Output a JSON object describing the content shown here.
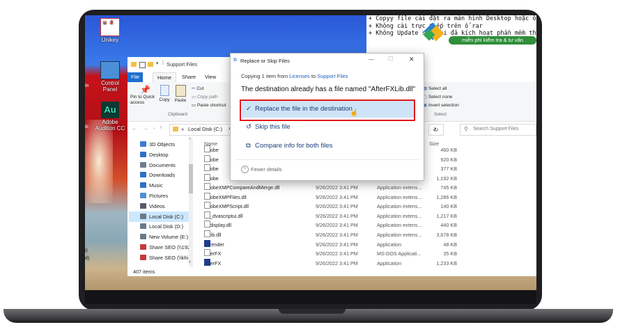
{
  "desktop": {
    "icons": [
      {
        "label": "Unikey"
      },
      {
        "label": "Control Panel"
      },
      {
        "label": "Adobe Audition CC"
      }
    ],
    "left_edge_text": [
      "in",
      "ic",
      "i)",
      "d)"
    ]
  },
  "console": {
    "lines": [
      "+ Copyy file cài đặt ra màn hình Desktop hoặc ổ",
      "+ Không cài trực tiếp trên ổ rar",
      "+ Không Update sau khi đã kích hoạt phần mềm thành"
    ]
  },
  "watermark": {
    "badge": "miễn phí kiểm tra & tư vấn"
  },
  "explorer": {
    "title": "Support Files",
    "tabs": [
      "File",
      "Home",
      "Share",
      "View"
    ],
    "ribbon": {
      "pin_label": "Pin to Quick access",
      "copy_label": "Copy",
      "paste_label": "Paste",
      "cut_label": "Cut",
      "copy_path_label": "Copy path",
      "paste_shortcut_label": "Paste shortcut",
      "clipboard_group": "Clipboard",
      "select_all": "Select all",
      "select_none": "Select none",
      "invert_selection": "Invert selection",
      "select_group": "Select"
    },
    "address": {
      "arrow": "«",
      "path": "Local Disk (C:)",
      "chevron": "›",
      "search_placeholder": "Search Support Files"
    },
    "nav": [
      {
        "label": "3D Objects",
        "color": "#3a7bd5"
      },
      {
        "label": "Desktop",
        "color": "#2f6fc9"
      },
      {
        "label": "Documents",
        "color": "#6d7d8f"
      },
      {
        "label": "Downloads",
        "color": "#2f6fc9"
      },
      {
        "label": "Music",
        "color": "#2f6fc9"
      },
      {
        "label": "Pictures",
        "color": "#4d8fd6"
      },
      {
        "label": "Videos",
        "color": "#5a5a6a"
      },
      {
        "label": "Local Disk (C:)",
        "color": "#6b7a88",
        "selected": true
      },
      {
        "label": "Local Disk (D:)",
        "color": "#6b7a88"
      },
      {
        "label": "New Volume (E:)",
        "color": "#6b7a88"
      },
      {
        "label": "Share SEO (\\\\192",
        "color": "#c8383a"
      },
      {
        "label": "Share SEO (\\\\khi",
        "color": "#c8383a"
      }
    ],
    "columns": {
      "name": "Name",
      "size": "Size"
    },
    "files": [
      {
        "name": "Adobe",
        "date": "",
        "type": "",
        "size": "460 KB"
      },
      {
        "name": "Adobe",
        "date": "",
        "type": "",
        "size": "920 KB"
      },
      {
        "name": "Adobe",
        "date": "",
        "type": "",
        "size": "377 KB"
      },
      {
        "name": "Adobe",
        "date": "",
        "type": "",
        "size": "1,192 KB"
      },
      {
        "name": "AdobeXMPCompareAndMerge.dll",
        "date": "9/26/2022 3:41 PM",
        "type": "Application extens...",
        "size": "745 KB"
      },
      {
        "name": "AdobeXMPFiles.dll",
        "date": "9/26/2022 3:41 PM",
        "type": "Application extens...",
        "size": "1,286 KB"
      },
      {
        "name": "AdobeXMPScript.dll",
        "date": "9/26/2022 3:41 PM",
        "type": "Application extens...",
        "size": "140 KB"
      },
      {
        "name": "ae_dvascriptui.dll",
        "date": "9/26/2022 3:41 PM",
        "type": "Application extens...",
        "size": "1,217 KB"
      },
      {
        "name": "aedisplay.dll",
        "date": "9/26/2022 3:41 PM",
        "type": "Application extens...",
        "size": "440 KB"
      },
      {
        "name": "aelib.dll",
        "date": "9/26/2022 3:41 PM",
        "type": "Application extens...",
        "size": "3,678 KB"
      },
      {
        "name": "aerender",
        "date": "9/26/2022 3:41 PM",
        "type": "Application",
        "size": "48 KB"
      },
      {
        "name": "AfterFX",
        "date": "9/26/2022 3:41 PM",
        "type": "MS-DOS Applicati...",
        "size": "35 KB"
      },
      {
        "name": "AfterFX",
        "date": "9/26/2022 3:41 PM",
        "type": "Application",
        "size": "1,233 KB"
      }
    ],
    "status": "407 items"
  },
  "dialog": {
    "title": "Replace or Skip Files",
    "copying_prefix": "Copying 1 item from ",
    "source": "Licenses",
    "to_word": " to ",
    "destination": "Support Files",
    "heading": "The destination already has a file named \"AfterFXLib.dll\"",
    "options": {
      "replace": "Replace the file in the destination",
      "skip": "Skip this file",
      "compare": "Compare info for both files"
    },
    "fewer_details": "Fewer details",
    "minimize": "—",
    "maximize": "☐",
    "close": "✕"
  },
  "colors": {
    "accent": "#1a5fb4",
    "highlight": "#cfe3f7",
    "callout": "#e3161b"
  }
}
